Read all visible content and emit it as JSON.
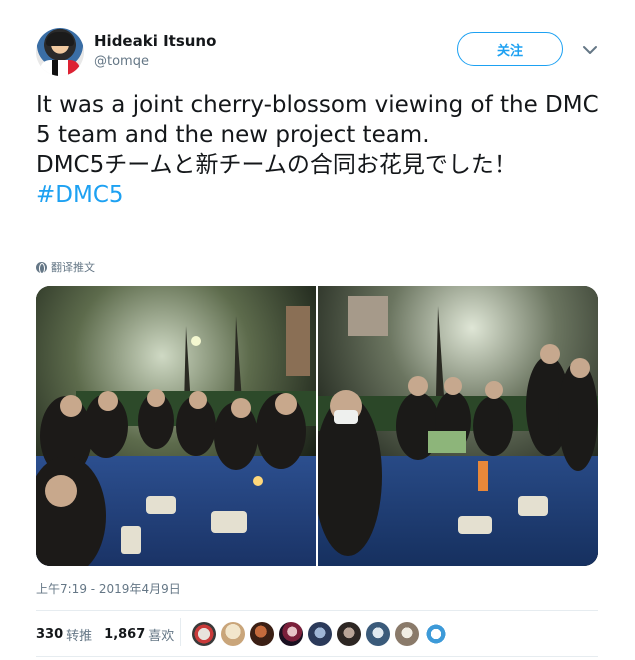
{
  "user": {
    "name": "Hideaki Itsuno",
    "handle": "@tomqe"
  },
  "follow_label": "关注",
  "tweet": {
    "line_en": "It was a joint cherry-blossom viewing of the DMC 5 team and the new project team.",
    "line_ja": "DMC5チームと新チームの合同お花見でした！",
    "hashtag": "#DMC5"
  },
  "translate_label": "翻译推文",
  "timestamp": "上午7:19 - 2019年4月9日",
  "stats": {
    "retweets": "330",
    "retweets_label": "转推",
    "likes": "1,867",
    "likes_label": "喜欢"
  },
  "colors": {
    "accent": "#1da1f2",
    "muted": "#657786",
    "text": "#14171a"
  },
  "icons": {
    "caret": "chevron-down-icon",
    "translate": "globe-icon"
  }
}
